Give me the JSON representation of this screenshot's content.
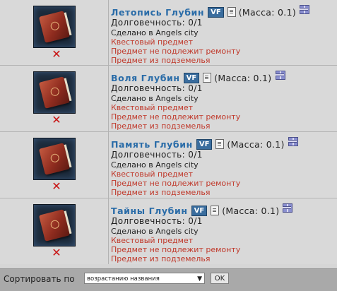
{
  "items": [
    {
      "name": "Летопись Глубин",
      "badge": "VF",
      "mass": "(Масса: 0.1)",
      "durability": "Долговечность: 0/1",
      "made_in": "Сделано в Angels city",
      "quest": "Квестовый предмет",
      "no_repair": "Предмет не подлежит ремонту",
      "dungeon": "Предмет из подземелья"
    },
    {
      "name": "Воля Глубин",
      "badge": "VF",
      "mass": "(Масса: 0.1)",
      "durability": "Долговечность: 0/1",
      "made_in": "Сделано в Angels city",
      "quest": "Квестовый предмет",
      "no_repair": "Предмет не подлежит ремонту",
      "dungeon": "Предмет из подземелья"
    },
    {
      "name": "Память Глубин",
      "badge": "VF",
      "mass": "(Масса: 0.1)",
      "durability": "Долговечность: 0/1",
      "made_in": "Сделано в Angels city",
      "quest": "Квестовый предмет",
      "no_repair": "Предмет не подлежит ремонту",
      "dungeon": "Предмет из подземелья"
    },
    {
      "name": "Тайны Глубин",
      "badge": "VF",
      "mass": "(Масса: 0.1)",
      "durability": "Долговечность: 0/1",
      "made_in": "Сделано в Angels city",
      "quest": "Квестовый предмет",
      "no_repair": "Предмет не подлежит ремонту",
      "dungeon": "Предмет из подземелья"
    }
  ],
  "icons": {
    "delete": "delete-x-icon",
    "info": "document-icon",
    "gift": "gift-icon",
    "item": "book-icon"
  },
  "colors": {
    "item_name": "#2a6ca8",
    "status_red": "#c0392b",
    "delete_red": "#c81414",
    "badge_bg": "#3a6d9e"
  },
  "footer": {
    "sort_label": "Сортировать по",
    "sort_value": "возрастанию названия",
    "ok_label": "OK"
  }
}
